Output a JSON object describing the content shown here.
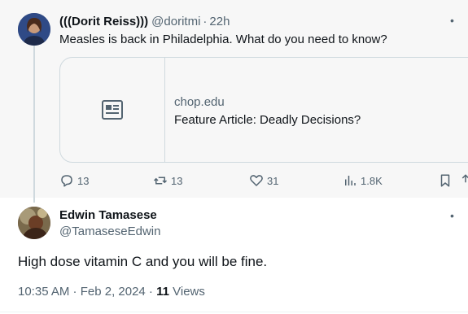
{
  "parent_tweet": {
    "display_name": "(((Dorit Reiss)))",
    "handle": "@doritmi",
    "separator": "·",
    "time": "22h",
    "text": "Measles is back in Philadelphia. What do you need to know?",
    "card": {
      "domain": "chop.edu",
      "title": "Feature Article: Deadly Decisions?",
      "thumb_icon": "article-icon"
    },
    "actions": {
      "replies": "13",
      "reposts": "13",
      "likes": "31",
      "views": "1.8K"
    }
  },
  "reply_tweet": {
    "display_name": "Edwin Tamasese",
    "handle": "@TamaseseEdwin",
    "text": "High dose vitamin C and you will be fine.",
    "timestamp": "10:35 AM · Feb 2, 2024 · ",
    "views_count": "11",
    "views_label": " Views"
  },
  "colors": {
    "text_primary": "#0f1419",
    "text_secondary": "#536471",
    "border": "#cfd9de",
    "parent_bg": "#f7f7f7"
  }
}
